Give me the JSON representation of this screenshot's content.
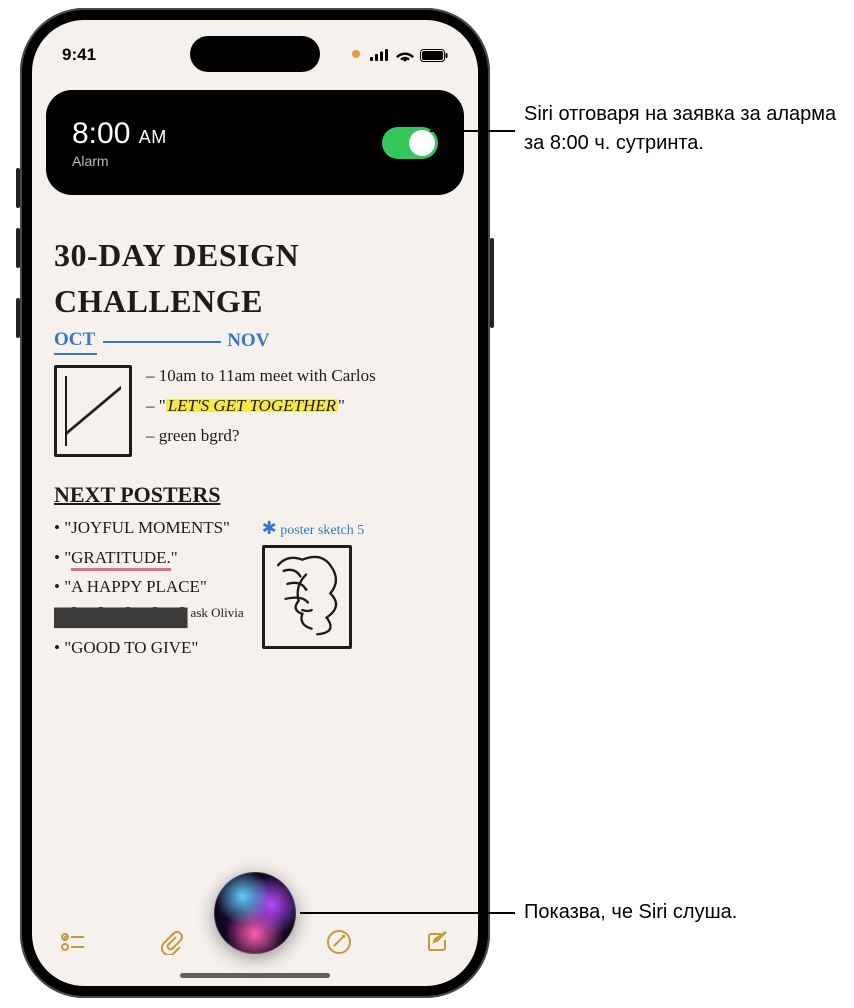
{
  "status": {
    "time": "9:41"
  },
  "alarm": {
    "time": "8:00",
    "ampm": "AM",
    "label": "Alarm"
  },
  "note": {
    "title_line1": "30-DAY DESIGN",
    "title_line2": "CHALLENGE",
    "month_start": "OCT",
    "month_end": "NOV",
    "meeting": "– 10am to 11am meet with Carlos",
    "slogan_prefix": "– \"",
    "slogan": "LET'S GET TOGETHER",
    "slogan_suffix": "\"",
    "green": "– green bgrd?",
    "section2_title": "NEXT POSTERS",
    "poster1": "• \"JOYFUL MOMENTS\"",
    "poster2_prefix": "• \"",
    "poster2": "GRATITUDE.",
    "poster2_suffix": "\"",
    "poster3": "• \"A HAPPY PLACE\"",
    "poster4_scribble": "████████████",
    "poster4_ask": "ask Olivia",
    "poster5": "• \"GOOD TO GIVE\"",
    "sketch_caption": "poster sketch 5"
  },
  "callouts": {
    "top": "Siri отговаря на заявка за аларма за 8:00 ч. сутринта.",
    "bottom": "Показва, че Siri слуша."
  }
}
